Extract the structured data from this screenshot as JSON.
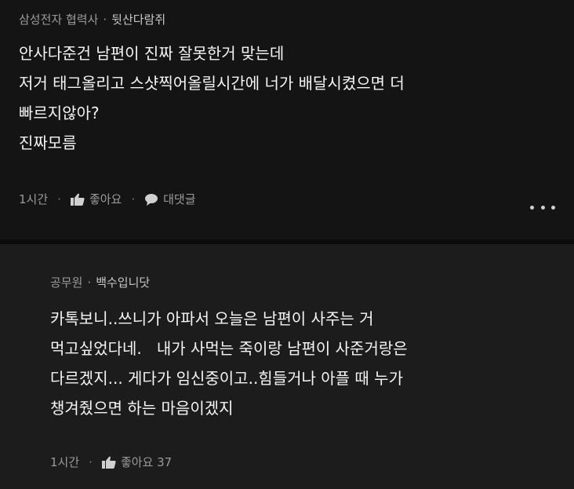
{
  "comments": [
    {
      "company": "삼성전자 협력사",
      "nickname": "뒷산다람쥐",
      "lines": [
        "안사다준건 남편이 진짜 잘못한거 맞는데",
        "저거 태그올리고 스샷찍어올릴시간에 너가 배달시켰으면 더",
        "빠르지않아?",
        "진짜모름"
      ],
      "time": "1시간",
      "like_label": "좋아요",
      "reply_label": "대댓글",
      "like_icon": "thumbs-up-icon",
      "reply_icon": "speech-bubble-icon",
      "more_icon": "more-dots-icon"
    },
    {
      "company": "공무원",
      "nickname": "백수입니닷",
      "lines": [
        "카톡보니..쓰니가 아파서 오늘은 남편이 사주는 거",
        "먹고싶었다네.   내가 사먹는 죽이랑 남편이 사준거랑은",
        "다르겠지... 게다가 임신중이고..힘들거나 아플 때 누가",
        "챙겨줬으면 하는 마음이겠지"
      ],
      "time": "1시간",
      "like_label": "좋아요 37",
      "like_icon": "thumbs-up-icon"
    }
  ],
  "colors": {
    "background": "#141414",
    "reply_background": "#1c1c1c",
    "meta_text": "#9b9b9b",
    "body_text": "#f5f5f5"
  }
}
